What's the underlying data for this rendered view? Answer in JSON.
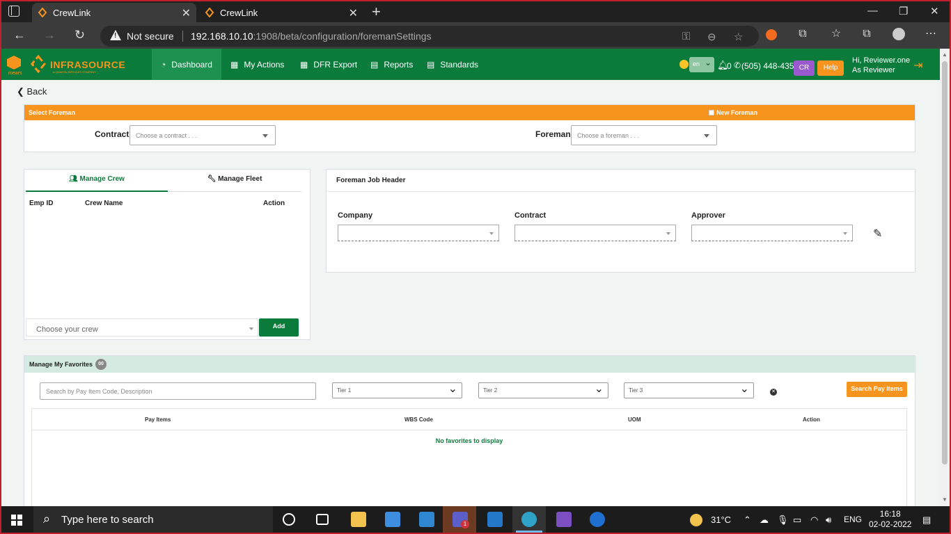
{
  "browser": {
    "tabs": [
      {
        "title": "CrewLink",
        "active": true
      },
      {
        "title": "CrewLink",
        "active": false
      }
    ],
    "security_label": "Not secure",
    "url_host": "192.168.10.10",
    "url_rest": ":1908/beta/configuration/foremanSettings"
  },
  "app": {
    "brand": "INFRASOURCE",
    "brand_tag": "A QUANTA SERVICES COMPANY",
    "parent_brand": "mears",
    "nav": [
      {
        "label": "Dashboard",
        "icon": "dashboard-icon",
        "active": true
      },
      {
        "label": "My Actions",
        "icon": "calendar-icon",
        "active": false
      },
      {
        "label": "DFR Export",
        "icon": "calendar-icon",
        "active": false
      },
      {
        "label": "Reports",
        "icon": "document-icon",
        "active": false
      },
      {
        "label": "Standards",
        "icon": "document-icon",
        "active": false
      }
    ],
    "language": "en",
    "notification_count": "0",
    "phone": "(505) 448-4357",
    "user_initials": "CR",
    "help_label": "Help",
    "greeting": "Hi, Reviewer.one",
    "role": "As Reviewer",
    "colors": {
      "primary": "#0b7b3b",
      "accent": "#f7941d",
      "badge": "#9b59d0"
    }
  },
  "page": {
    "back_label": "Back",
    "select_foreman": {
      "title": "Select Foreman",
      "new_foreman_label": "New Foreman",
      "contract_label": "Contract",
      "contract_placeholder": "Choose a contract . . .",
      "foreman_label": "Foreman",
      "foreman_placeholder": "Choose a foreman . . ."
    },
    "crew_panel": {
      "tabs": [
        {
          "label": "Manage Crew",
          "icon": "users-icon",
          "active": true
        },
        {
          "label": "Manage Fleet",
          "icon": "wrench-icon",
          "active": false
        }
      ],
      "columns": [
        "Emp ID",
        "Crew Name",
        "Action"
      ],
      "crew_placeholder": "Choose your crew",
      "add_label": "Add"
    },
    "job_header": {
      "title": "Foreman Job Header",
      "company_label": "Company",
      "contract_label": "Contract",
      "approver_label": "Approver"
    },
    "favorites": {
      "title": "Manage My Favorites",
      "count": "00",
      "search_placeholder": "Search by Pay Item Code, Description",
      "tiers": [
        "Tier 1",
        "Tier 2",
        "Tier 3"
      ],
      "search_button": "Search Pay items",
      "columns": [
        "Pay Items",
        "WBS Code",
        "UOM",
        "Action"
      ],
      "empty_message": "No favorites to display"
    }
  },
  "taskbar": {
    "search_placeholder": "Type here to search",
    "temperature": "31°C",
    "language": "ENG",
    "time": "16:18",
    "date": "02-02-2022",
    "teams_badge": "1"
  }
}
